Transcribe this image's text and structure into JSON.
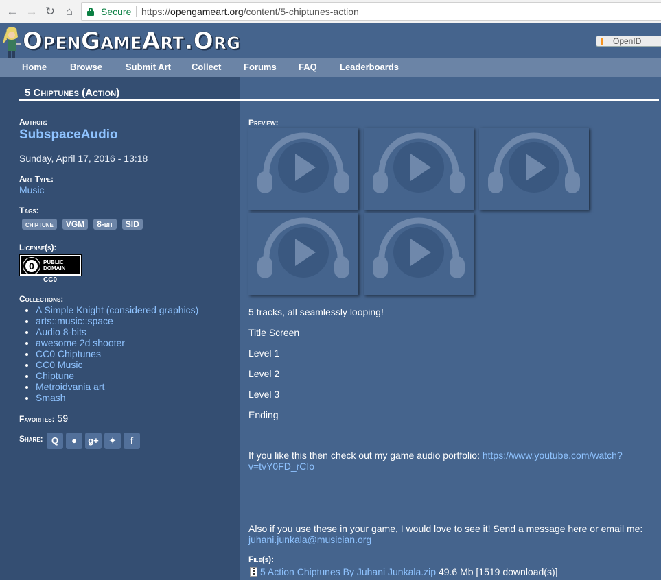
{
  "browser": {
    "secure_label": "Secure",
    "url_scheme": "https://",
    "url_host": "opengameart.org",
    "url_path": "/content/5-chiptunes-action",
    "icons": [
      "back-arrow-icon",
      "forward-arrow-icon",
      "reload-icon",
      "home-icon",
      "lock-icon"
    ]
  },
  "site": {
    "logo_text": "OpenGameArt.Org",
    "openid_label": "OpenID"
  },
  "nav": {
    "items": [
      {
        "label": "Home"
      },
      {
        "label": "Browse"
      },
      {
        "label": "Submit Art"
      },
      {
        "label": "Collect"
      },
      {
        "label": "Forums"
      },
      {
        "label": "FAQ"
      },
      {
        "label": "Leaderboards"
      }
    ]
  },
  "page": {
    "title": "5 Chiptunes (Action)",
    "author_label": "Author:",
    "author_name": "SubspaceAudio",
    "date": "Sunday, April 17, 2016 - 13:18",
    "art_type_label": "Art Type:",
    "art_type": "Music",
    "tags_label": "Tags:",
    "tags": [
      "chiptune",
      "VGM",
      "8-bit",
      "SID"
    ],
    "license_label": "License(s):",
    "license_badge_line1": "PUBLIC",
    "license_badge_line2": "DOMAIN",
    "license_badge_zero": "0",
    "license_name": "CC0",
    "collections_label": "Collections:",
    "collections": [
      "A Simple Knight (considered graphics)",
      "arts::music::space",
      "Audio 8-bits",
      "awesome 2d shooter",
      "CC0 Chiptunes",
      "CC0 Music",
      "Chiptune",
      "Metroidvania art",
      "Smash"
    ],
    "favorites_label": "Favorites:",
    "favorites_count": "59",
    "share_label": "Share:",
    "share_icons": [
      "openid-share-icon",
      "reddit-icon",
      "google-plus-icon",
      "twitter-icon",
      "facebook-icon"
    ],
    "share_glyphs": [
      "Q",
      "●",
      "g+",
      "✦",
      "f"
    ]
  },
  "content": {
    "preview_label": "Preview:",
    "player_count": 5,
    "description": [
      "5 tracks, all seamlessly looping!",
      "Title Screen",
      "Level 1",
      "Level 2",
      "Level 3",
      "Ending"
    ],
    "portfolio_text": "If you like this then check out my game audio portfolio: ",
    "portfolio_link_line1": "https://www.youtube.com/watch?",
    "portfolio_link_line2": "v=tvY0FD_rCIo",
    "contact_text": "Also if you use these in your game, I would love to see it! Send a message here or email me:",
    "contact_email": "juhani.junkala@musician.org",
    "files_label": "File(s):",
    "file_name": "5 Action Chiptunes By Juhani Junkala.zip",
    "file_size": "49.6 Mb",
    "file_downloads": "[1519 download(s)]"
  },
  "colors": {
    "background": "#45648d",
    "sidebar": "#344e72",
    "navbar": "#6b84a6",
    "link": "#8fc3ff",
    "secure_green": "#0b8043"
  }
}
